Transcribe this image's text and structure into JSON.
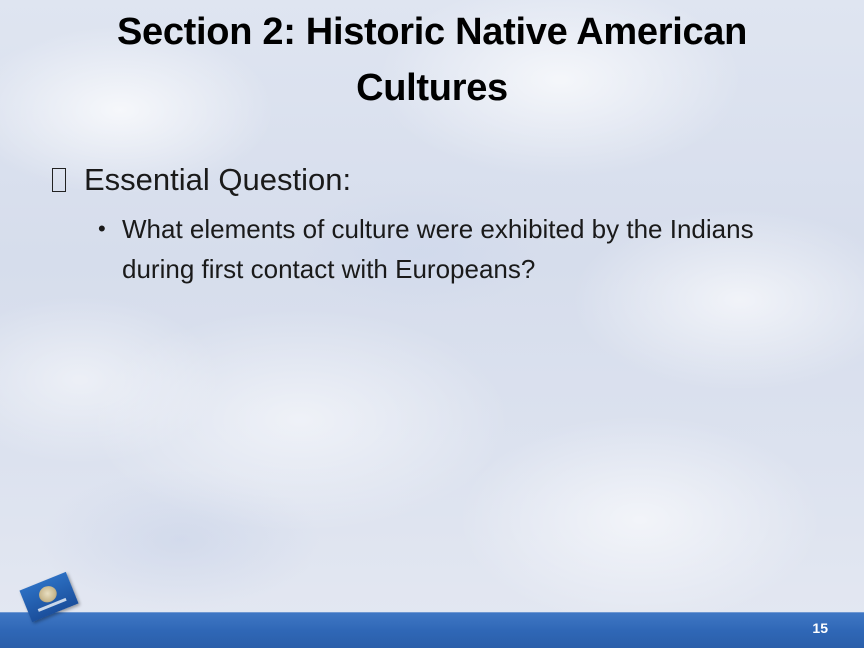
{
  "slide": {
    "title": "Section 2: Historic Native American Cultures",
    "bullets": [
      {
        "text": "Essential Question:",
        "children": [
          "What elements of culture were exhibited by the Indians during first contact with Europeans?"
        ]
      }
    ],
    "page_number": "15"
  },
  "colors": {
    "footer_bar": "#2f67b6",
    "background": "#d9e0ee",
    "title_text": "#000000"
  },
  "icons": {
    "level1_bullet": "hollow-square-bullet-icon",
    "level2_bullet": "dot-bullet-icon",
    "logo": "oklahoma-flag-icon"
  }
}
